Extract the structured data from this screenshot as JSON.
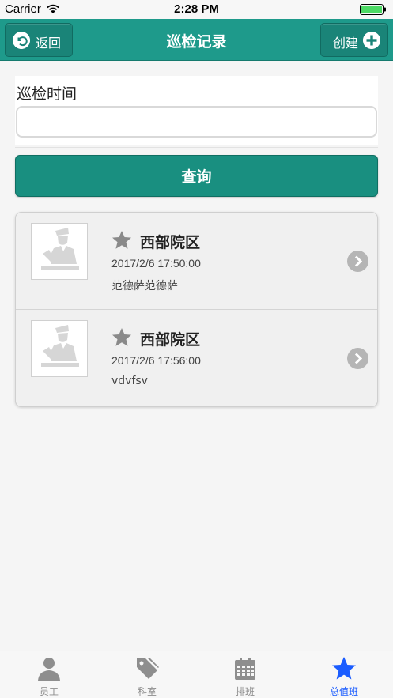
{
  "status_bar": {
    "carrier": "Carrier",
    "time": "2:28 PM"
  },
  "nav": {
    "back_label": "返回",
    "title": "巡检记录",
    "create_label": "创建"
  },
  "form": {
    "time_label": "巡检时间",
    "time_value": "",
    "query_label": "查询"
  },
  "records": [
    {
      "title": "西部院区",
      "time": "2017/2/6 17:50:00",
      "desc": "范德萨范德萨"
    },
    {
      "title": "西部院区",
      "time": "2017/2/6 17:56:00",
      "desc": "vdvfsv"
    }
  ],
  "tabs": [
    {
      "label": "员工",
      "icon": "person-icon",
      "active": false
    },
    {
      "label": "科室",
      "icon": "tag-icon",
      "active": false
    },
    {
      "label": "排班",
      "icon": "calendar-icon",
      "active": false
    },
    {
      "label": "总值班",
      "icon": "star-icon",
      "active": true
    }
  ],
  "colors": {
    "nav_bg": "#1e9a8b",
    "button_bg": "#198f80",
    "active_tab": "#1a5cff",
    "inactive_tab": "#8e8e8e"
  }
}
